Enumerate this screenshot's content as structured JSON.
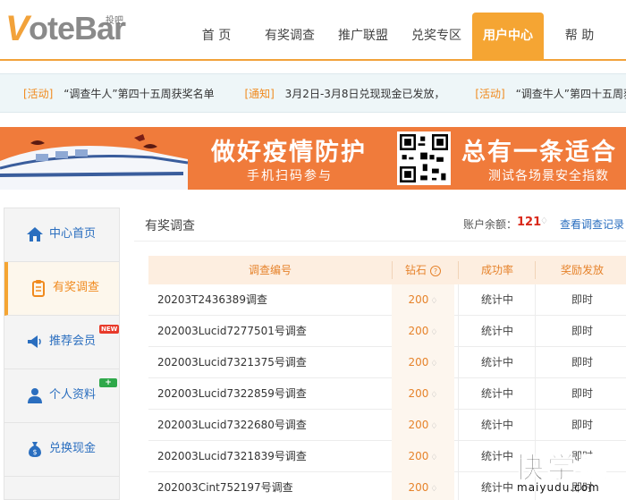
{
  "header": {
    "logo_text": "oteBar",
    "logo_v": "V",
    "logo_sub": "投吧",
    "nav": [
      {
        "label": "首 页"
      },
      {
        "label": "有奖调查"
      },
      {
        "label": "推广联盟"
      },
      {
        "label": "兑奖专区"
      },
      {
        "label": "用户中心",
        "active": true
      },
      {
        "label": "帮 助"
      }
    ]
  },
  "notices": [
    {
      "tag": "[活动]",
      "text": "“调查牛人”第四十五周获奖名单"
    },
    {
      "tag": "[通知]",
      "text": "3月2日-3月8日兑现现金已发放，"
    },
    {
      "tag": "[活动]",
      "text": "“调查牛人”第四十五周获奖名单"
    }
  ],
  "banner": {
    "title": "做好疫情防护",
    "subtitle": "手机扫码参与",
    "title2": "总有一条适合",
    "subtitle2": "测试各场景安全指数"
  },
  "sidebar": {
    "items": [
      {
        "label": "中心首页",
        "icon": "home-icon"
      },
      {
        "label": "有奖调查",
        "icon": "clipboard-icon",
        "active": true
      },
      {
        "label": "推荐会员",
        "icon": "megaphone-icon",
        "badge": "NEW"
      },
      {
        "label": "个人资料",
        "icon": "user-icon",
        "badge": "+"
      },
      {
        "label": "兑换现金",
        "icon": "money-bag-icon"
      }
    ]
  },
  "main": {
    "title": "有奖调查",
    "balance_label": "账户余额：",
    "balance_value": "121",
    "view_link": "查看调查记录"
  },
  "table": {
    "headers": [
      "调查编号",
      "钻石",
      "成功率",
      "奖励发放"
    ],
    "rows": [
      {
        "id": "20203T2436389调查",
        "gems": "200",
        "rate": "统计中",
        "award": "即时"
      },
      {
        "id": "202003Lucid7277501号调查",
        "gems": "200",
        "rate": "统计中",
        "award": "即时"
      },
      {
        "id": "202003Lucid7321375号调查",
        "gems": "200",
        "rate": "统计中",
        "award": "即时"
      },
      {
        "id": "202003Lucid7322859号调查",
        "gems": "200",
        "rate": "统计中",
        "award": "即时"
      },
      {
        "id": "202003Lucid7322680号调查",
        "gems": "200",
        "rate": "统计中",
        "award": "即时"
      },
      {
        "id": "202003Lucid7321839号调查",
        "gems": "200",
        "rate": "统计中",
        "award": "即时"
      },
      {
        "id": "202003Cint752197号调查",
        "gems": "200",
        "rate": "统计中",
        "award": "即时"
      }
    ]
  },
  "watermark": {
    "title": "快学赚",
    "sub": "maiyudu.com"
  },
  "colors": {
    "accent": "#f5a533",
    "link": "#2a6ebf",
    "banner": "#f07b3b"
  }
}
